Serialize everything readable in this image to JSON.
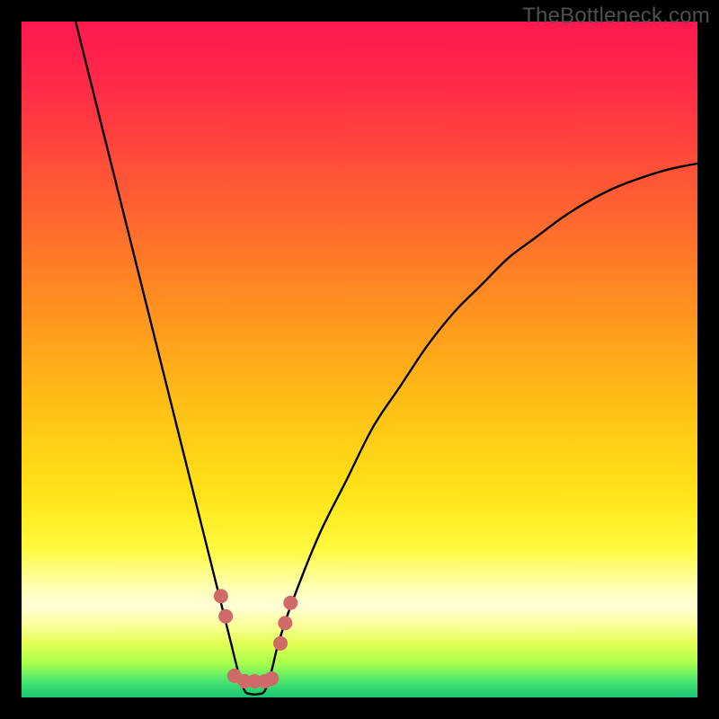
{
  "watermark": "TheBottleneck.com",
  "chart_data": {
    "type": "line",
    "title": "",
    "xlabel": "",
    "ylabel": "",
    "xlim": [
      0,
      100
    ],
    "ylim": [
      0,
      100
    ],
    "grid": false,
    "legend": false,
    "description": "Single V-shaped bottleneck curve over a vertical red-to-green gradient with a pale yellow band near the bottom. Salmon dots mark the minimum region.",
    "series": [
      {
        "name": "bottleneck-curve",
        "x": [
          8,
          10,
          12,
          14,
          16,
          18,
          20,
          22,
          24,
          26,
          28,
          29,
          30,
          31,
          32,
          33,
          34,
          35,
          36,
          37,
          38,
          40,
          44,
          48,
          52,
          56,
          60,
          64,
          68,
          72,
          76,
          80,
          84,
          88,
          92,
          96,
          100
        ],
        "y": [
          100,
          92,
          84,
          76,
          68,
          60,
          52,
          44,
          36,
          28,
          20,
          16,
          12,
          8,
          4,
          1,
          0.5,
          0.5,
          1,
          4,
          8,
          14,
          24,
          32,
          40,
          46,
          52,
          57,
          61,
          65,
          68,
          71,
          73.5,
          75.5,
          77,
          78.2,
          79
        ]
      }
    ],
    "markers": {
      "name": "curve-dots",
      "x": [
        29.5,
        30.2,
        31.5,
        33.0,
        34.5,
        36.0,
        37.0,
        38.3,
        39.0,
        39.8
      ],
      "y": [
        15.0,
        12.0,
        3.2,
        2.4,
        2.4,
        2.4,
        2.8,
        8.0,
        11.0,
        14.0
      ],
      "color": "#cf6a69",
      "radius": 8
    },
    "gradient_stops": [
      {
        "offset": 0.0,
        "color": "#ff1850"
      },
      {
        "offset": 0.1,
        "color": "#ff2c47"
      },
      {
        "offset": 0.25,
        "color": "#ff5a34"
      },
      {
        "offset": 0.4,
        "color": "#ff8a22"
      },
      {
        "offset": 0.55,
        "color": "#ffba16"
      },
      {
        "offset": 0.7,
        "color": "#ffe418"
      },
      {
        "offset": 0.78,
        "color": "#fff93e"
      },
      {
        "offset": 0.835,
        "color": "#ffffb0"
      },
      {
        "offset": 0.865,
        "color": "#ffffd8"
      },
      {
        "offset": 0.89,
        "color": "#fdffa0"
      },
      {
        "offset": 0.92,
        "color": "#e4ff55"
      },
      {
        "offset": 0.95,
        "color": "#a7ff4a"
      },
      {
        "offset": 0.975,
        "color": "#4be66e"
      },
      {
        "offset": 1.0,
        "color": "#17c574"
      }
    ]
  }
}
